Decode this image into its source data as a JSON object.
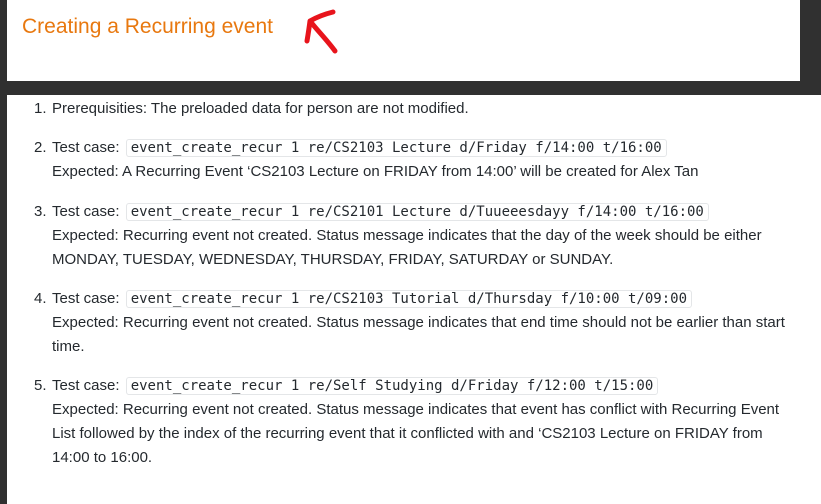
{
  "header": {
    "title": "Creating a Recurring event",
    "title_color": "#e8780f",
    "annotation_color": "#e8141c",
    "annotation_icon": "hand-drawn-arrow-icon"
  },
  "steps": [
    {
      "number": "1.",
      "text": "Prerequisities: The preloaded data for person are not modified."
    },
    {
      "number": "2.",
      "label": "Test case:",
      "command": "event_create_recur 1 re/CS2103 Lecture d/Friday f/14:00 t/16:00",
      "expected": "Expected: A Recurring Event ‘CS2103 Lecture on FRIDAY from 14:00’ will be created for Alex Tan"
    },
    {
      "number": "3.",
      "label": "Test case:",
      "command": "event_create_recur 1 re/CS2101 Lecture d/Tuueeesdayy f/14:00 t/16:00",
      "expected": "Expected: Recurring event not created. Status message indicates that the day of the week should be either MONDAY, TUESDAY, WEDNESDAY, THURSDAY, FRIDAY, SATURDAY or SUNDAY."
    },
    {
      "number": "4.",
      "label": "Test case:",
      "command": "event_create_recur 1 re/CS2103 Tutorial d/Thursday f/10:00 t/09:00",
      "expected": "Expected: Recurring event not created. Status message indicates that end time should not be earlier than start time."
    },
    {
      "number": "5.",
      "label": "Test case:",
      "command": "event_create_recur 1 re/Self Studying d/Friday f/12:00 t/15:00",
      "expected": "Expected: Recurring event not created. Status message indicates that event has conflict with Recurring Event List followed by the index of the recurring event that it conflicted with and ‘CS2103 Lecture on FRIDAY from 14:00 to 16:00."
    }
  ]
}
